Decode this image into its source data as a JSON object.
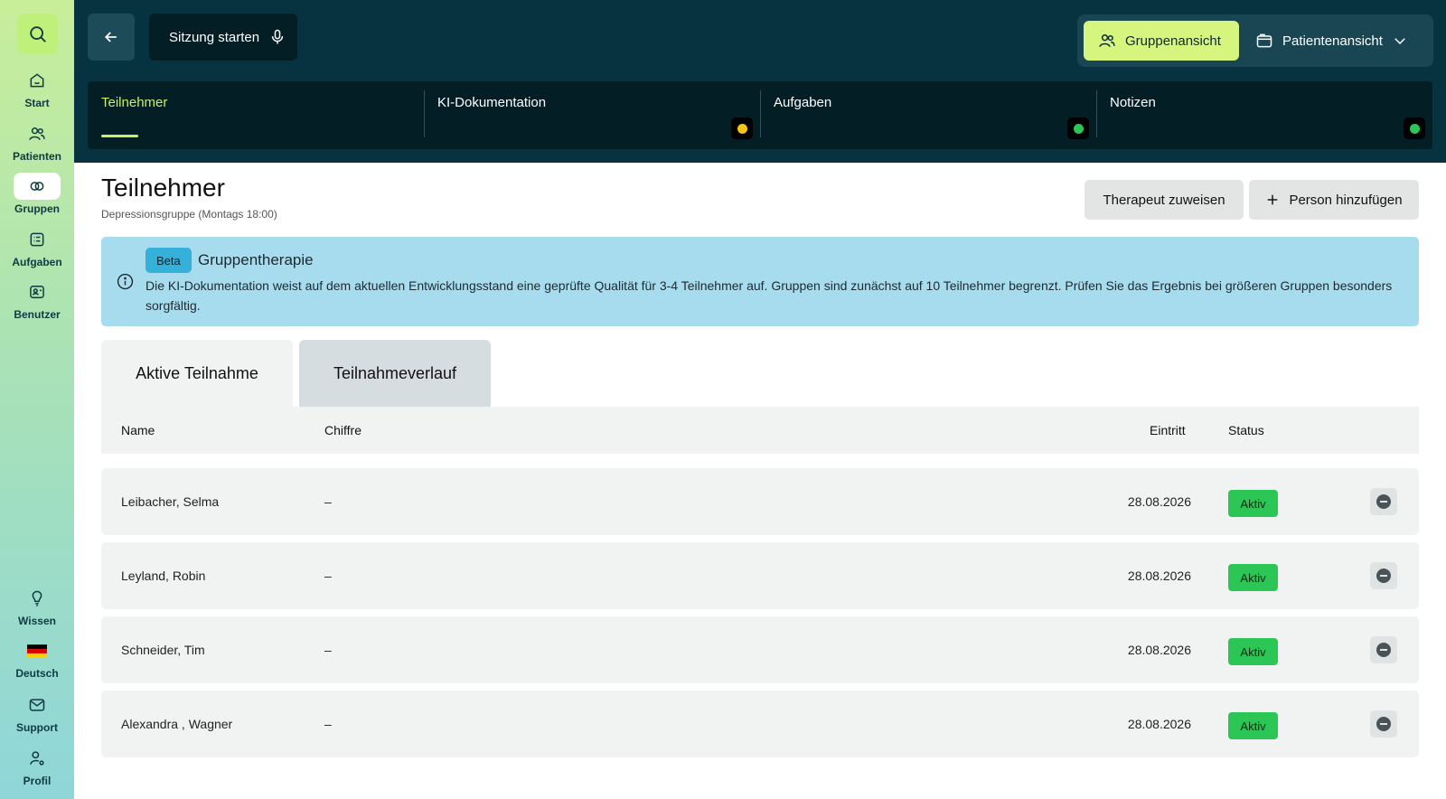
{
  "sidebar": {
    "items": [
      {
        "label": "Start",
        "icon": "home-icon"
      },
      {
        "label": "Patienten",
        "icon": "users-icon"
      },
      {
        "label": "Gruppen",
        "icon": "groups-icon"
      },
      {
        "label": "Aufgaben",
        "icon": "tasks-icon"
      },
      {
        "label": "Benutzer",
        "icon": "user-card-icon"
      },
      {
        "label": "Wissen",
        "icon": "lightbulb-icon"
      },
      {
        "label": "Deutsch",
        "icon": "german-flag-icon"
      },
      {
        "label": "Support",
        "icon": "mail-icon"
      },
      {
        "label": "Profil",
        "icon": "profile-icon"
      }
    ]
  },
  "header": {
    "session_label": "Sitzung starten",
    "view_group": "Gruppenansicht",
    "view_patient": "Patientenansicht",
    "tabs": [
      {
        "label": "Teilnehmer"
      },
      {
        "label": "KI-Dokumentation",
        "dot_color": "#f5c518"
      },
      {
        "label": "Aufgaben",
        "dot_color": "#2cc657"
      },
      {
        "label": "Notizen",
        "dot_color": "#2cc657"
      }
    ]
  },
  "main": {
    "title": "Teilnehmer",
    "subtitle": "Depressionsgruppe (Montags 18:00)",
    "btn_assign": "Therapeut zuweisen",
    "btn_add": "Person hinzufügen",
    "banner": {
      "badge": "Beta",
      "title": "Gruppentherapie",
      "text": "Die KI-Dokumentation weist auf dem aktuellen Entwicklungsstand eine geprüfte Qualität für 3-4 Teilnehmer auf. Gruppen sind zunächst auf 10 Teilnehmer begrenzt. Prüfen Sie das Ergebnis bei größeren Gruppen besonders sorgfältig."
    },
    "subtabs": [
      "Aktive Teilnahme",
      "Teilnahmeverlauf"
    ],
    "table": {
      "headers": {
        "name": "Name",
        "chiffre": "Chiffre",
        "eintritt": "Eintritt",
        "status": "Status"
      },
      "rows": [
        {
          "name": "Leibacher, Selma",
          "chiffre": "–",
          "eintritt": "28.08.2026",
          "status": "Aktiv"
        },
        {
          "name": "Leyland, Robin",
          "chiffre": "–",
          "eintritt": "28.08.2026",
          "status": "Aktiv"
        },
        {
          "name": "Schneider, Tim",
          "chiffre": "–",
          "eintritt": "28.08.2026",
          "status": "Aktiv"
        },
        {
          "name": "Alexandra , Wagner",
          "chiffre": "–",
          "eintritt": "28.08.2026",
          "status": "Aktiv"
        }
      ]
    }
  },
  "colors": {
    "accent_lime": "#d6f57f",
    "header_bg": "#06333f",
    "status_green": "#2cc657",
    "banner_bg": "#a7dcef"
  }
}
